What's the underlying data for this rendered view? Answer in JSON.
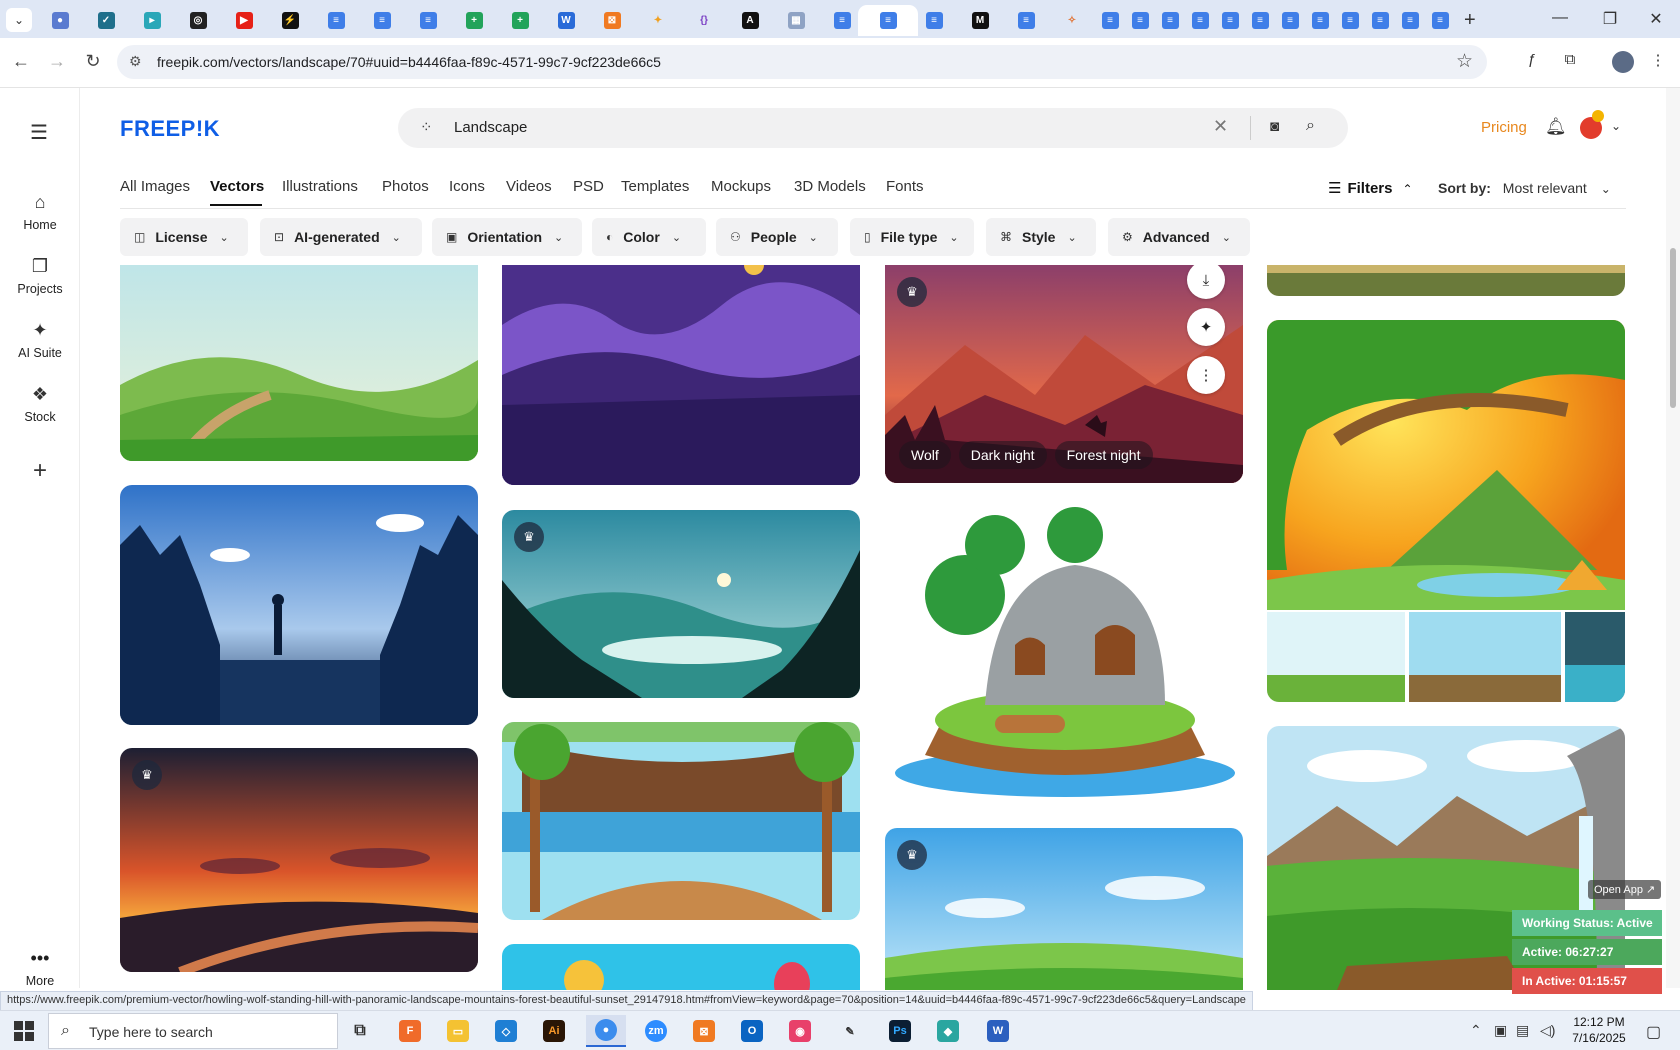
{
  "browser": {
    "url": "freepik.com/vectors/landscape/70#uuid=b4446faa-f89c-4571-99c7-9cf223de66c5",
    "status_url": "https://www.freepik.com/premium-vector/howling-wolf-standing-hill-with-panoramic-landscape-mountains-forest-beautiful-sunset_29147918.htm#fromView=keyword&page=70&position=14&uuid=b4446faa-f89c-4571-99c7-9cf223de66c5&query=Landscape",
    "new_tab_glyph": "+",
    "back_glyph": "←",
    "forward_glyph": "→",
    "reload_glyph": "↻",
    "star_glyph": "☆",
    "minimize_glyph": "—",
    "restore_glyph": "❐",
    "close_glyph": "✕"
  },
  "app": {
    "logo": "FREEP!K",
    "search": {
      "query": "Landscape"
    },
    "pricing_label": "Pricing",
    "rail": [
      {
        "label": "Home",
        "icon": "home-icon"
      },
      {
        "label": "Projects",
        "icon": "folder-icon"
      },
      {
        "label": "AI Suite",
        "icon": "sparkle-icon"
      },
      {
        "label": "Stock",
        "icon": "stock-icon"
      }
    ],
    "more_label": "More",
    "type_tabs": [
      "All Images",
      "Vectors",
      "Illustrations",
      "Photos",
      "Icons",
      "Videos",
      "PSD",
      "Templates",
      "Mockups",
      "3D Models",
      "Fonts"
    ],
    "active_tab": "Vectors",
    "filters_label": "Filters",
    "sort_label": "Sort by:",
    "sort_value": "Most relevant",
    "chips": [
      "License",
      "AI-generated",
      "Orientation",
      "Color",
      "People",
      "File type",
      "Style",
      "Advanced"
    ],
    "hovered_tags": [
      "Wolf",
      "Dark night",
      "Forest night"
    ]
  },
  "tracker": {
    "open_app": "Open App ↗",
    "status": "Working Status: Active",
    "active": "Active: 06:27:27",
    "inactive": "In Active: 01:15:57",
    "colors": {
      "status": "#5bc08a",
      "active": "#4ca85c",
      "inactive": "#e0504a"
    }
  },
  "taskbar": {
    "search_placeholder": "Type here to search",
    "time": "12:12 PM",
    "date": "7/16/2025"
  },
  "colors": {
    "brand": "#0f5ee6",
    "pricing": "#e8881e"
  }
}
